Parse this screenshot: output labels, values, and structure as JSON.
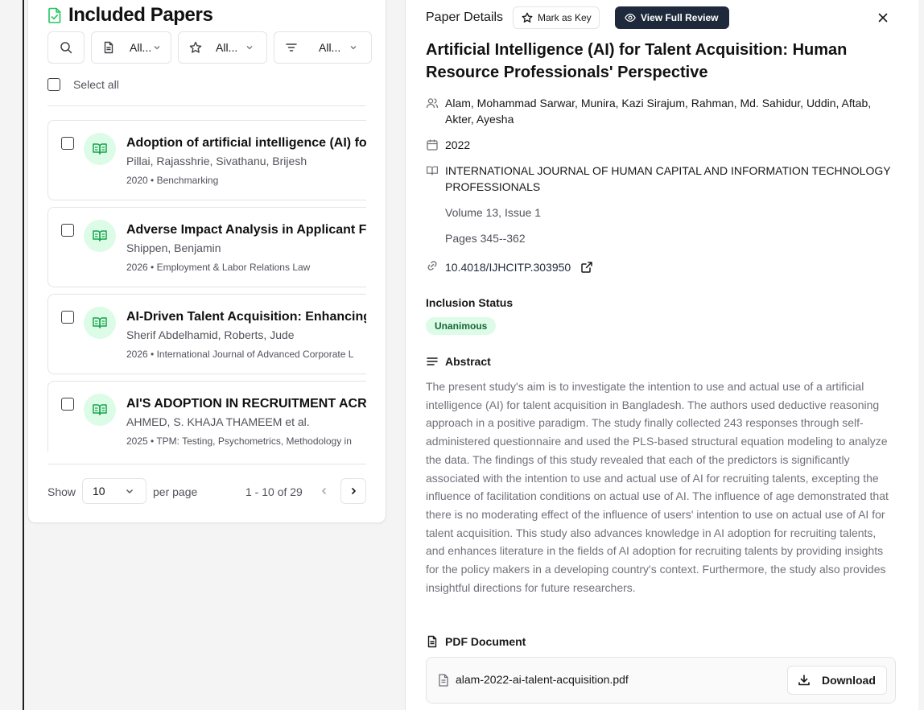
{
  "list_panel": {
    "title": "Included Papers",
    "filters": {
      "type_label": "All...",
      "star_label": "All...",
      "sort_label": "All..."
    },
    "select_all_label": "Select all",
    "papers": [
      {
        "title": "Adoption of artificial intelligence (AI) for",
        "authors": "Pillai, Rajasshrie, Sivathanu, Brijesh",
        "meta": "2020 • Benchmarking"
      },
      {
        "title": "Adverse Impact Analysis in Applicant Flo",
        "authors": "Shippen, Benjamin",
        "meta": "2026 • Employment & Labor Relations Law"
      },
      {
        "title": "AI-Driven Talent Acquisition: Enhancing I",
        "authors": "Sherif Abdelhamid, Roberts, Jude",
        "meta": "2026 • International Journal of Advanced Corporate L"
      },
      {
        "title": "AI'S ADOPTION IN RECRUITMENT ACRO",
        "authors": "AHMED, S. KHAJA THAMEEM et al.",
        "meta": "2025 • TPM: Testing, Psychometrics, Methodology in"
      }
    ],
    "pagination": {
      "show_label": "Show",
      "per_page_value": "10",
      "per_page_label": "per page",
      "range": "1 - 10 of 29"
    }
  },
  "details": {
    "header_label": "Paper Details",
    "mark_key_label": "Mark as Key",
    "view_review_label": "View Full Review",
    "title": "Artificial Intelligence (AI) for Talent Acquisition: Human Resource Professionals' Perspective",
    "authors": "Alam, Mohammad Sarwar, Munira, Kazi Sirajum, Rahman, Md. Sahidur, Uddin, Aftab, Akter, Ayesha",
    "year": "2022",
    "journal": "INTERNATIONAL JOURNAL OF HUMAN CAPITAL AND INFORMATION TECHNOLOGY PROFESSIONALS",
    "volume": "Volume 13, Issue 1",
    "pages": "Pages 345--362",
    "doi": "10.4018/IJHCITP.303950",
    "inclusion_label": "Inclusion Status",
    "inclusion_status": "Unanimous",
    "abstract_label": "Abstract",
    "abstract": "The present study's aim is to investigate the intention to use and actual use of a artificial intelligence (AI) for talent acquisition in Bangladesh. The authors used deductive reasoning approach in a positive paradigm. The study finally collected 243 responses through self-administered questionnaire and used the PLS-based structural equation modeling to analyze the data. The findings of this study revealed that each of the predictors is significantly associated with the intention to use and actual use of AI for recruiting talents, excepting the influence of facilitation conditions on actual use of AI. The influence of age demonstrated that there is no moderating effect of the influence of users' intention to use on actual use of AI for talent acquisition. This study also advances knowledge in AI adoption for recruiting talents, and enhances literature in the fields of AI adoption for recruiting talents by providing insights for the policy makers in a developing country's context. Furthermore, the study also provides insightful directions for future researchers.",
    "pdf_label": "PDF Document",
    "pdf_filename": "alam-2022-ai-talent-acquisition.pdf",
    "download_label": "Download"
  },
  "colors": {
    "accent_green": "#22c55e",
    "badge_green_bg": "#dcfce7",
    "primary_dark": "#1e293b"
  }
}
